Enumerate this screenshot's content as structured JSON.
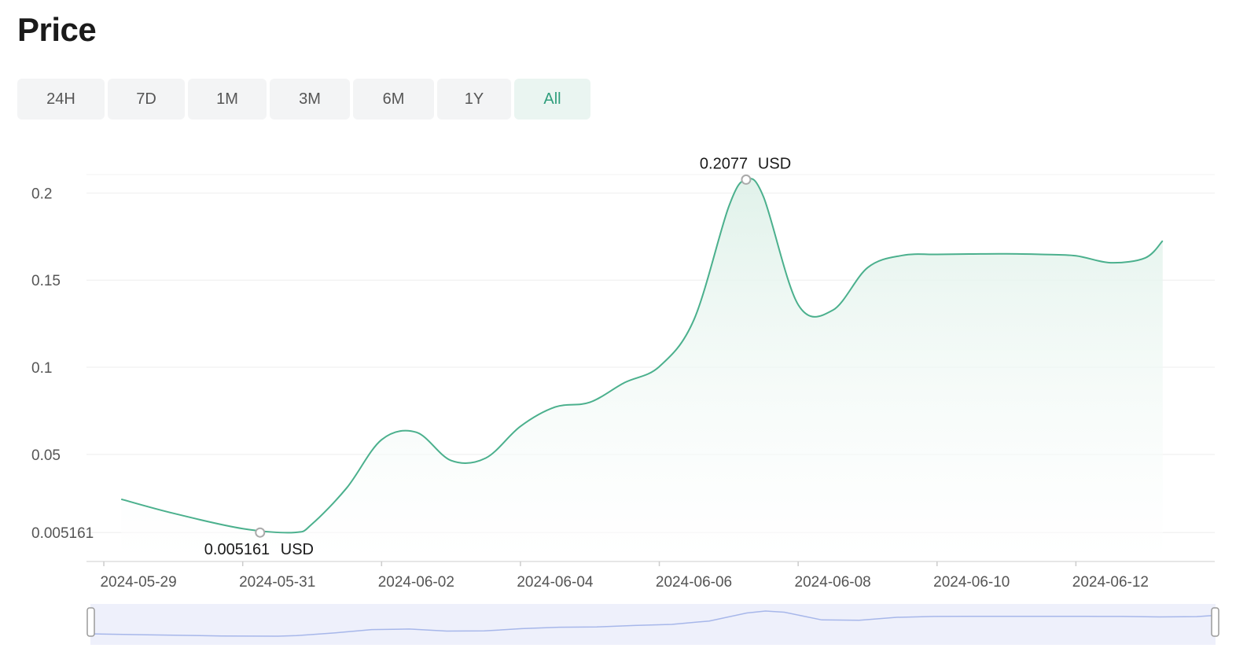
{
  "page": {
    "title": "Price"
  },
  "tabs": [
    {
      "label": "24H"
    },
    {
      "label": "7D"
    },
    {
      "label": "1M"
    },
    {
      "label": "3M"
    },
    {
      "label": "6M"
    },
    {
      "label": "1Y"
    },
    {
      "label": "All",
      "active": true
    }
  ],
  "colors": {
    "line": "#4bb08d",
    "fill": "#e4f3ec",
    "grid": "#eeeeee",
    "axis_text": "#555555",
    "active_tab": "#2f9e7c",
    "navigator_bg": "#eef0fb",
    "navigator_line": "#a7b7ea"
  },
  "chart_data": {
    "type": "area",
    "x": [
      "2024-05-29 06:00",
      "2024-05-30",
      "2024-05-31",
      "2024-05-31 18:00",
      "2024-06-01",
      "2024-06-01 12:00",
      "2024-06-02",
      "2024-06-02 12:00",
      "2024-06-03",
      "2024-06-03 12:00",
      "2024-06-04",
      "2024-06-04 12:00",
      "2024-06-05",
      "2024-06-05 12:00",
      "2024-06-06",
      "2024-06-06 12:00",
      "2024-06-07",
      "2024-06-07 06:00",
      "2024-06-07 12:00",
      "2024-06-08",
      "2024-06-08 12:00",
      "2024-06-09",
      "2024-06-09 12:00",
      "2024-06-10",
      "2024-06-10 12:00",
      "2024-06-11",
      "2024-06-11 12:00",
      "2024-06-12",
      "2024-06-12 12:00",
      "2024-06-13",
      "2024-06-13 06:00"
    ],
    "y": [
      0.0243,
      0.0162,
      0.0074,
      0.0052,
      0.0101,
      0.0309,
      0.0584,
      0.0627,
      0.0465,
      0.0479,
      0.0661,
      0.0772,
      0.0799,
      0.0912,
      0.1004,
      0.1274,
      0.1921,
      0.2077,
      0.1979,
      0.1359,
      0.1328,
      0.1572,
      0.1642,
      0.1648,
      0.165,
      0.1651,
      0.1648,
      0.164,
      0.16,
      0.1628,
      0.1726
    ],
    "markers": [
      {
        "x": "2024-05-31 06:00",
        "y": 0.005161,
        "label": "0.005161",
        "unit": "USD"
      },
      {
        "x": "2024-06-07 06:00",
        "y": 0.2077,
        "label": "0.2077",
        "unit": "USD"
      }
    ],
    "xticks": [
      "2024-05-29",
      "2024-05-31",
      "2024-06-02",
      "2024-06-04",
      "2024-06-06",
      "2024-06-08",
      "2024-06-10",
      "2024-06-12"
    ],
    "yticks": [
      {
        "value": 0.005161,
        "label": "0.005161"
      },
      {
        "value": 0.05,
        "label": "0.05"
      },
      {
        "value": 0.1,
        "label": "0.1"
      },
      {
        "value": 0.15,
        "label": "0.15"
      },
      {
        "value": 0.2,
        "label": "0.2"
      }
    ],
    "xlim": [
      "2024-05-28 18:00",
      "2024-06-14"
    ],
    "ylim": [
      -0.011,
      0.216
    ],
    "grid": true,
    "title": "",
    "xlabel": "",
    "ylabel": "",
    "navigator": true
  }
}
